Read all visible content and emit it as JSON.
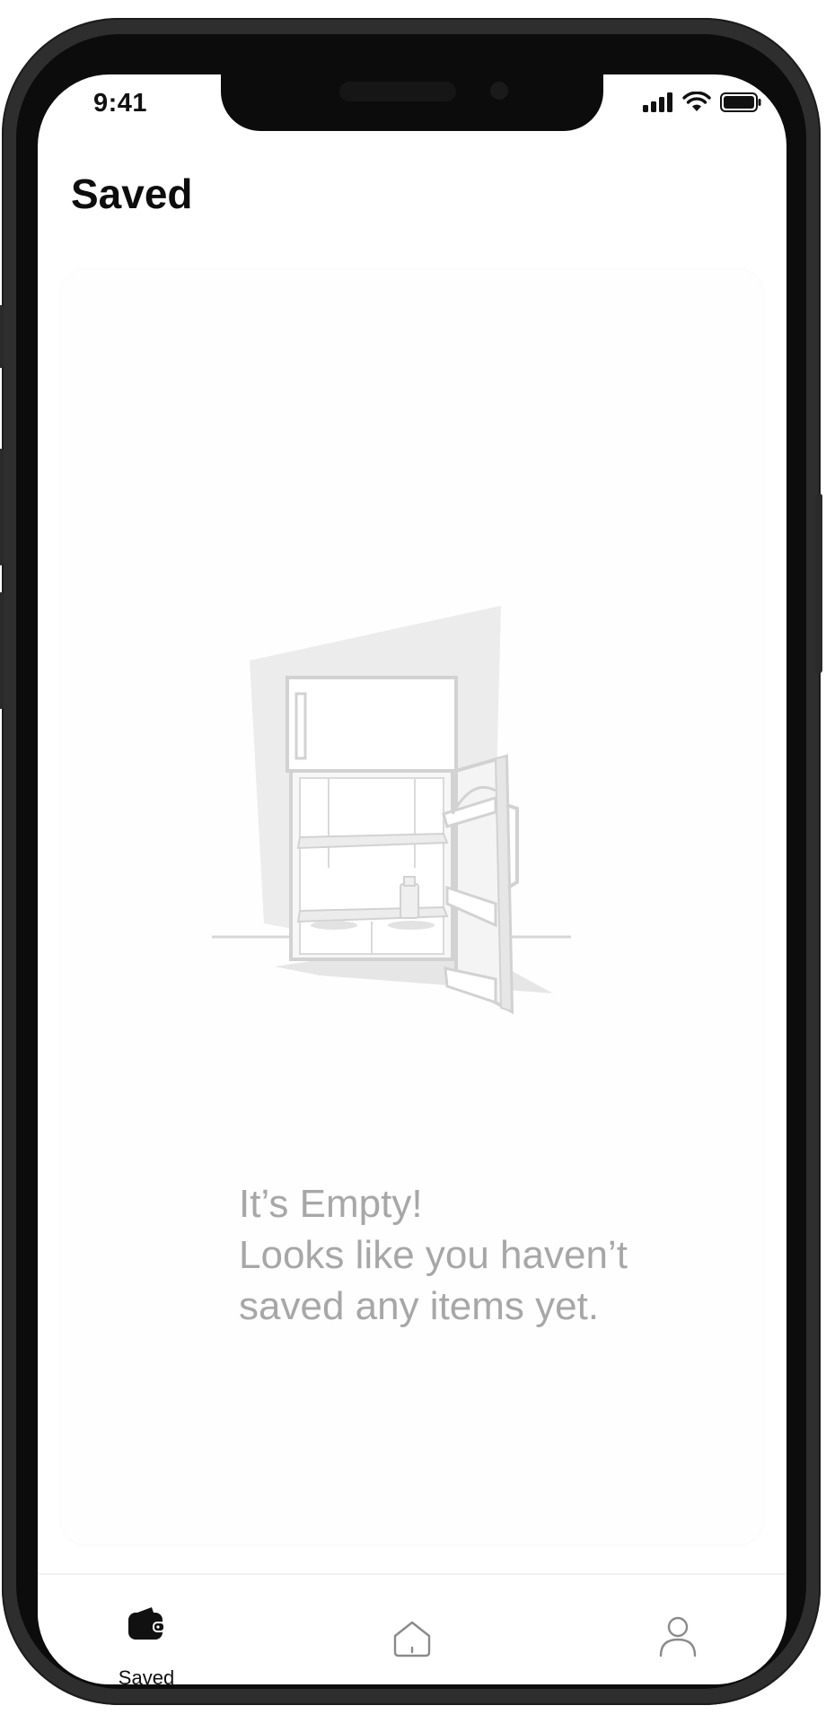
{
  "status_bar": {
    "time": "9:41",
    "icons": [
      "signal-icon",
      "wifi-icon",
      "battery-icon"
    ]
  },
  "header": {
    "title": "Saved"
  },
  "empty_state": {
    "illustration": "open-empty-fridge-illustration",
    "line1": "It’s Empty!",
    "line2": "Looks like you haven’t",
    "line3": "saved any items yet."
  },
  "tabbar": {
    "tabs": [
      {
        "label": "Saved",
        "icon": "wallet-icon",
        "active": true
      },
      {
        "label": "",
        "icon": "home-icon",
        "active": false
      },
      {
        "label": "",
        "icon": "profile-icon",
        "active": false
      }
    ]
  },
  "colors": {
    "text_primary": "#0d0d0d",
    "text_muted": "#a7a7a7",
    "frame": "#2e2e2e",
    "illustration_stroke": "#d4d4d4",
    "illustration_fill": "#eeeeee"
  }
}
